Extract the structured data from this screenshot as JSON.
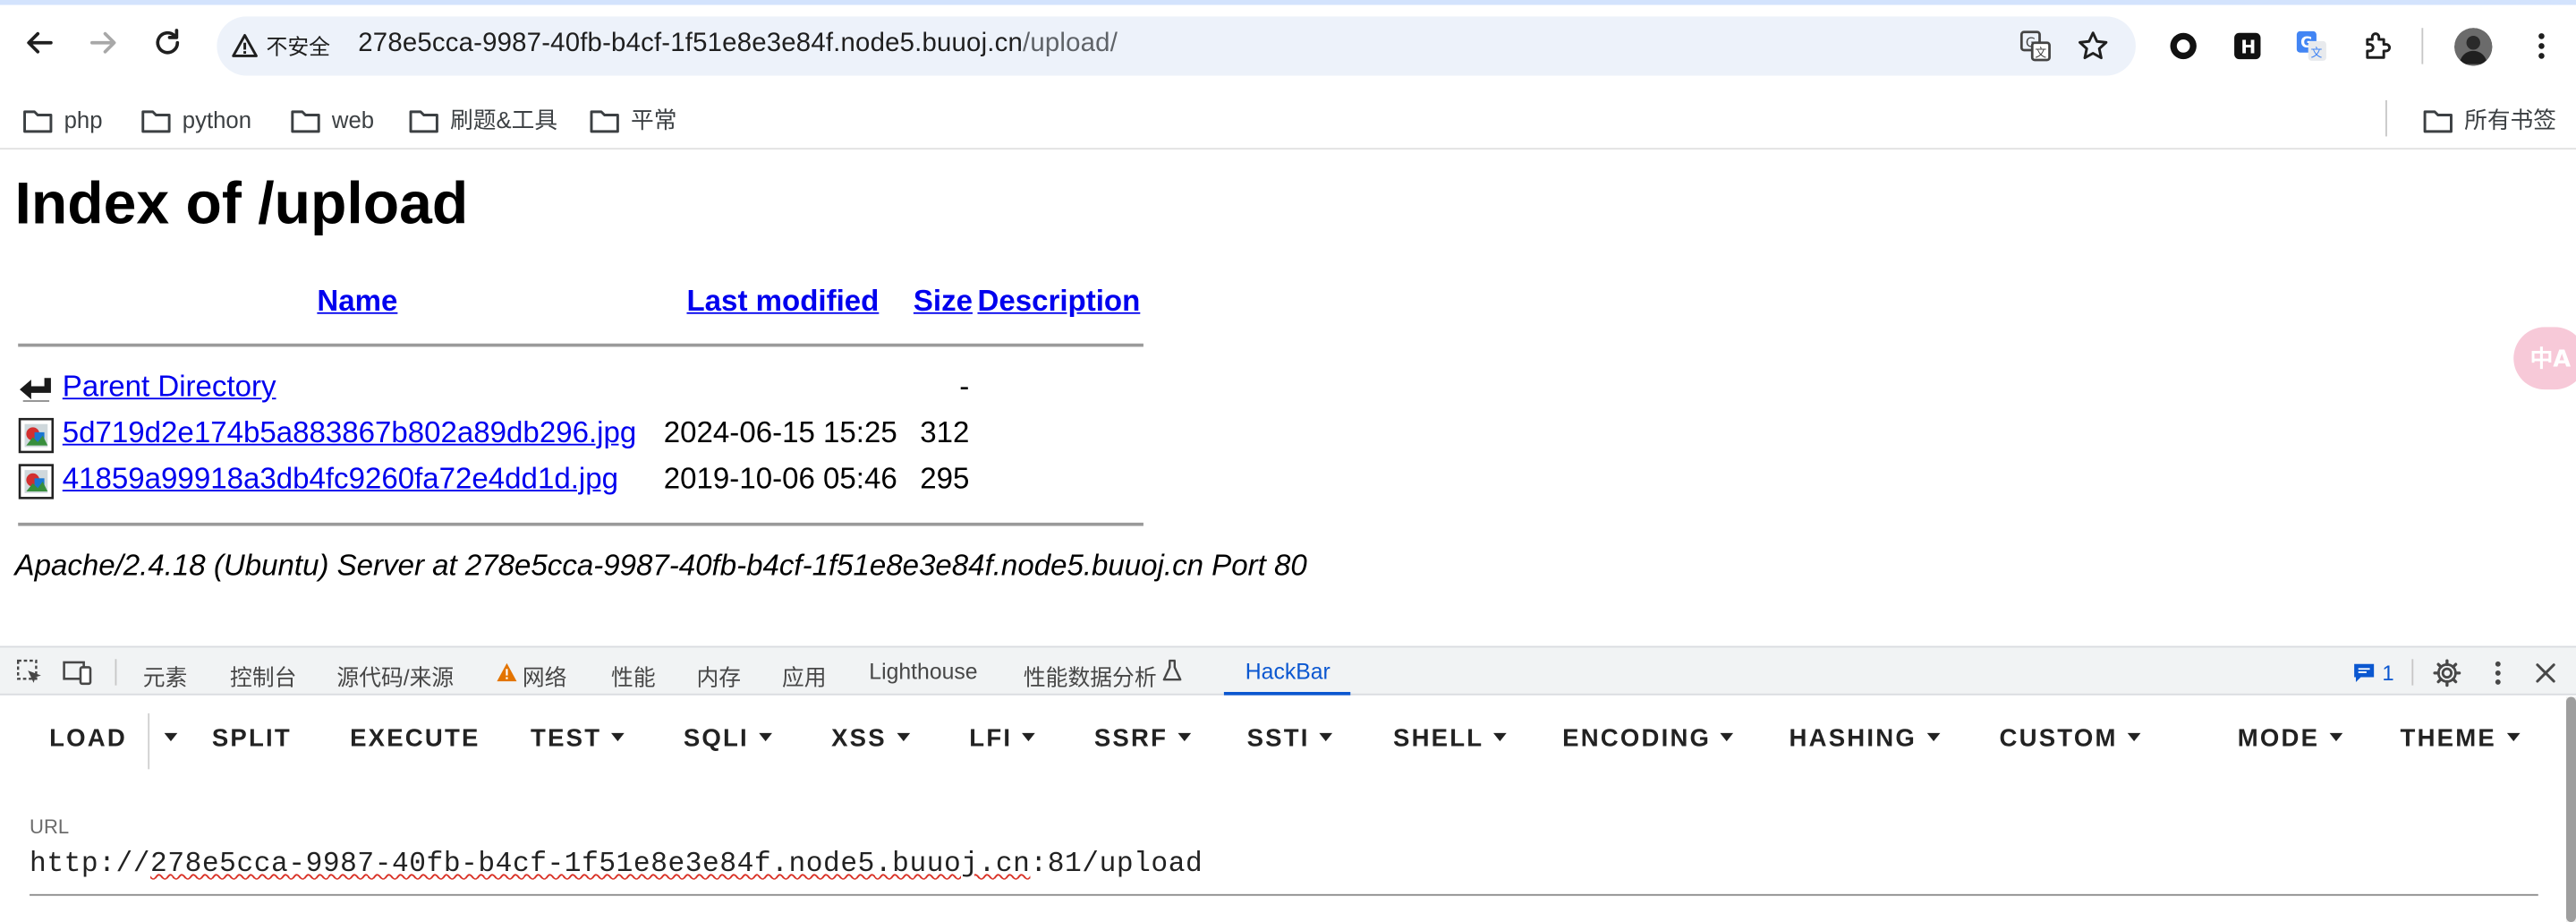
{
  "browser": {
    "security_label": "不安全",
    "url_host": "278e5cca-9987-40fb-b4cf-1f51e8e3e84f.node5.buuoj.cn",
    "url_path": "/upload/"
  },
  "bookmarks": {
    "items": [
      "php",
      "python",
      "web",
      "刷题&工具",
      "平常"
    ],
    "all_label": "所有书签"
  },
  "page": {
    "title": "Index of /upload",
    "columns": {
      "name": "Name",
      "last_modified": "Last modified",
      "size": "Size",
      "description": "Description"
    },
    "rows": [
      {
        "name": "Parent Directory",
        "modified": "",
        "size": "-",
        "icon": "back-icon"
      },
      {
        "name": "5d719d2e174b5a883867b802a89db296.jpg",
        "modified": "2024-06-15 15:25",
        "size": "312",
        "icon": "image-file-icon"
      },
      {
        "name": "41859a99918a3db4fc9260fa72e4dd1d.jpg",
        "modified": "2019-10-06 05:46",
        "size": "295",
        "icon": "image-file-icon"
      }
    ],
    "server_signature": "Apache/2.4.18 (Ubuntu) Server at 278e5cca-9987-40fb-b4cf-1f51e8e3e84f.node5.buuoj.cn Port 80",
    "translate_badge": "中A"
  },
  "devtools": {
    "tabs": [
      "元素",
      "控制台",
      "源代码/来源",
      "网络",
      "性能",
      "内存",
      "应用",
      "Lighthouse",
      "性能数据分析",
      "HackBar"
    ],
    "active_tab": "HackBar",
    "issues_count": "1"
  },
  "hackbar": {
    "buttons": [
      "LOAD",
      "SPLIT",
      "EXECUTE",
      "TEST",
      "SQLI",
      "XSS",
      "LFI",
      "SSRF",
      "SSTI",
      "SHELL",
      "ENCODING",
      "HASHING",
      "CUSTOM",
      "MODE",
      "THEME"
    ],
    "url_label": "URL",
    "url_prefix": "http://",
    "url_host": "278e5cca-9987-40fb-b4cf-1f51e8e3e84f.node5.buuoj.cn",
    "url_suffix": ":81/upload"
  }
}
